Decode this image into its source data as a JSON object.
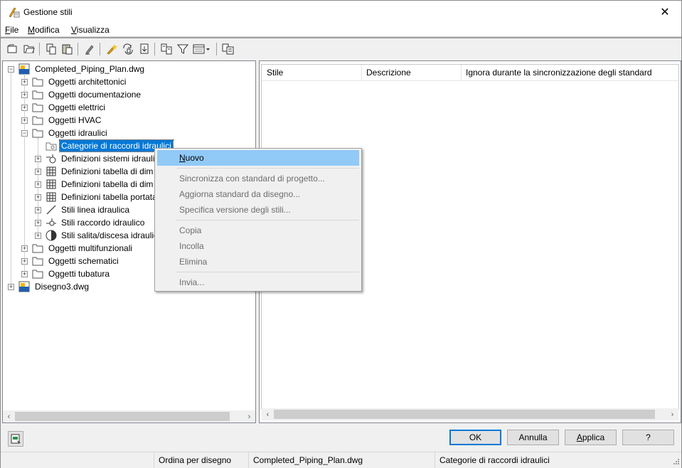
{
  "window": {
    "title": "Gestione stili",
    "close_glyph": "✕"
  },
  "menubar": [
    {
      "label": "File",
      "u": "F",
      "rest": "ile"
    },
    {
      "label": "Modifica",
      "u": "M",
      "rest": "odifica"
    },
    {
      "label": "Visualizza",
      "u": "V",
      "rest": "isualizza"
    }
  ],
  "toolbar": {
    "icons": [
      "new-drawing-icon",
      "open-drawing-icon",
      "copy-icon",
      "paste-icon",
      "edit-icon",
      "purge-icon",
      "sync-icon",
      "update-icon",
      "compare-icon",
      "filter-icon",
      "view-toggle-icon",
      "inventory-icon"
    ]
  },
  "tree": {
    "root1": "Completed_Piping_Plan.dwg",
    "children": [
      "Oggetti architettonici",
      "Oggetti documentazione",
      "Oggetti elettrici",
      "Oggetti HVAC",
      "Oggetti idraulici"
    ],
    "plumbing_children": [
      "Categorie di raccordi idraulici",
      "Definizioni sistemi idraulici",
      "Definizioni tabella di dim",
      "Definizioni tabella di dim",
      "Definizioni tabella portata",
      "Stili linea idraulica",
      "Stili raccordo idraulico",
      "Stili salita/discesa idraulica"
    ],
    "after": [
      "Oggetti multifunzionali",
      "Oggetti schematici",
      "Oggetti tubatura"
    ],
    "root2": "Disegno3.dwg"
  },
  "list_headers": [
    "Stile",
    "Descrizione",
    "Ignora durante la sincronizzazione degli standard"
  ],
  "context_menu": {
    "items": [
      {
        "label": "Nuovo",
        "active": true
      },
      {
        "label": "Sincronizza con standard di progetto...",
        "active": false
      },
      {
        "label": "Aggiorna standard da disegno...",
        "active": false
      },
      {
        "label": "Specifica versione degli stili...",
        "active": false
      },
      {
        "label": "Copia",
        "active": false
      },
      {
        "label": "Incolla",
        "active": false
      },
      {
        "label": "Elimina",
        "active": false
      },
      {
        "label": "Invia...",
        "active": false
      }
    ]
  },
  "buttons": {
    "ok": "OK",
    "cancel": "Annulla",
    "apply": "Applica",
    "help": "?"
  },
  "status": {
    "sort": "Ordina per disegno",
    "drawing": "Completed_Piping_Plan.dwg",
    "selection": "Categorie di raccordi idraulici"
  },
  "colors": {
    "selection": "#0078d7",
    "menu_highlight": "#91c9f7",
    "default_button_border": "#0078d7"
  }
}
